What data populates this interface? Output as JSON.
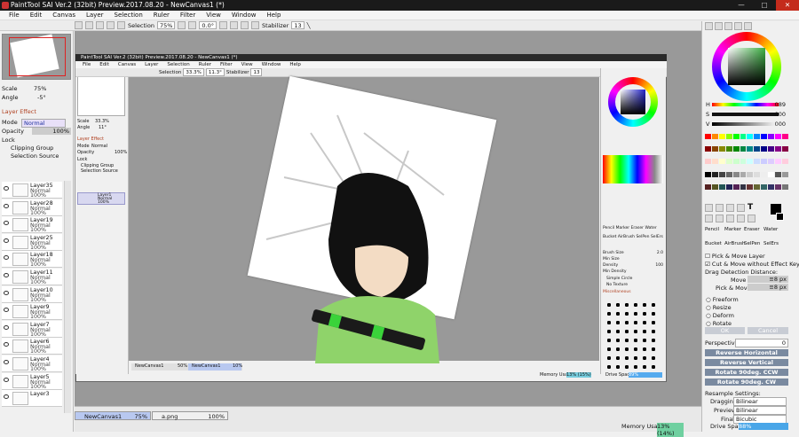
{
  "window": {
    "title": "PaintTool SAI Ver.2 (32bit) Preview.2017.08.20 - NewCanvas1 (*)",
    "min": "—",
    "max": "□",
    "close": "✕"
  },
  "menu": [
    "File",
    "Edit",
    "Canvas",
    "Layer",
    "Selection",
    "Ruler",
    "Filter",
    "View",
    "Window",
    "Help"
  ],
  "toolbar": {
    "selection_label": "Selection",
    "zoom": "75%",
    "angle": "0.0°",
    "stabilizer_label": "Stabilizer",
    "stabilizer_value": "13"
  },
  "left": {
    "scale_label": "Scale",
    "scale_value": "75%",
    "angle_label": "Angle",
    "angle_value": "-5°",
    "layer_effect": "Layer Effect",
    "mode_label": "Mode",
    "mode_value": "Normal",
    "opacity_label": "Opacity",
    "opacity_value": "100%",
    "lock_label": "Lock",
    "clipping_group": "Clipping Group",
    "selection_source": "Selection Source",
    "layers": [
      {
        "name": "Layer35",
        "mode": "Normal",
        "opacity": "100%"
      },
      {
        "name": "Layer28",
        "mode": "Normal",
        "opacity": "100%"
      },
      {
        "name": "Layer19",
        "mode": "Normal",
        "opacity": "100%"
      },
      {
        "name": "Layer25",
        "mode": "Normal",
        "opacity": "100%"
      },
      {
        "name": "Layer18",
        "mode": "Normal",
        "opacity": "100%"
      },
      {
        "name": "Layer11",
        "mode": "Normal",
        "opacity": "100%"
      },
      {
        "name": "Layer10",
        "mode": "Normal",
        "opacity": "100%"
      },
      {
        "name": "Layer9",
        "mode": "Normal",
        "opacity": "100%"
      },
      {
        "name": "Layer7",
        "mode": "Normal",
        "opacity": "100%"
      },
      {
        "name": "Layer6",
        "mode": "Normal",
        "opacity": "100%"
      },
      {
        "name": "Layer4",
        "mode": "Normal",
        "opacity": "100%"
      },
      {
        "name": "Layer5",
        "mode": "Normal",
        "opacity": "100%"
      },
      {
        "name": "Layer3",
        "mode": "",
        "opacity": ""
      }
    ]
  },
  "right": {
    "h_label": "H",
    "h_value": "089",
    "s_label": "S",
    "s_value": "000",
    "v_label": "V",
    "v_value": "000",
    "tools": [
      "Pencil",
      "Marker",
      "Eraser",
      "Water",
      "Bucket",
      "AirBrush",
      "SelPen",
      "SelErs"
    ],
    "pick_move_layer": "Pick & Move Layer",
    "cut_move": "Cut & Move without Effect Key",
    "drag_detection": "Drag Detection Distance:",
    "move_label": "Move",
    "move_value": "≡8 px",
    "pickmove_label": "Pick & Move",
    "pickmove_value": "≡8 px",
    "freeform": "Freeform",
    "resize": "Resize",
    "deform": "Deform",
    "rotate": "Rotate",
    "ok": "OK",
    "cancel": "Cancel",
    "perspective_label": "Perspective",
    "perspective_value": "0",
    "reverse_h": "Reverse Horizontal",
    "reverse_v": "Reverse Vertical",
    "rot_ccw": "Rotate 90deg. CCW",
    "rot_cw": "Rotate 90deg. CW",
    "resample_label": "Resample Settings:",
    "dragging_label": "Dragging",
    "dragging_value": "Bilinear",
    "preview_label": "Preview",
    "preview_value": "Bilinear",
    "final_label": "Final",
    "final_value": "Bicubic"
  },
  "inner": {
    "title": "PaintTool SAI Ver.2 (32bit) Preview.2017.08.20 - NewCanvas1 (*)",
    "menu": [
      "File",
      "Edit",
      "Canvas",
      "Layer",
      "Selection",
      "Ruler",
      "Filter",
      "View",
      "Window",
      "Help"
    ],
    "selection": "Selection",
    "zoom": "33.3%",
    "angle": "11.3°",
    "stabilizer": "Stabilizer",
    "stab_val": "13",
    "layer_name": "Layer1",
    "layer_mode": "Normal",
    "layer_op": "100%",
    "doc1": "NewCanvas1",
    "doc1_z": "50%",
    "doc2": "NewCanvas1",
    "doc2_z": "10%",
    "memory": "Memory Usage",
    "memory_v": "13% (15%)",
    "drive": "Drive Space",
    "drive_v": "89%",
    "tools": [
      "Pencil",
      "Marker",
      "Eraser",
      "Water",
      "Bucket",
      "AirBrush",
      "SelPen",
      "SelErs"
    ],
    "brush_size": "Brush Size",
    "brush_size_v": "2.0",
    "min_size": "Min Size",
    "density": "Density",
    "density_v": "100",
    "min_density": "Min Density",
    "simple_circle": "Simple Circle",
    "no_texture": "No Texture",
    "misc": "Miscellaneous",
    "scale": "Scale",
    "scale_v": "33.3%",
    "angle_l": "Angle",
    "angle_v": "11°",
    "layer_effect": "Layer Effect",
    "mode": "Mode",
    "mode_v": "Normal",
    "opacity": "Opacity",
    "opacity_v": "100%",
    "lock": "Lock",
    "clip": "Clipping Group",
    "selsrc": "Selection Source"
  },
  "docs": {
    "tab1_name": "NewCanvas1",
    "tab1_zoom": "75%",
    "tab2_name": "a.png",
    "tab2_zoom": "100%"
  },
  "status": {
    "memory_label": "Memory Usage",
    "memory_value": "13% (14%)",
    "drive_label": "Drive Space",
    "drive_value": "88%"
  }
}
